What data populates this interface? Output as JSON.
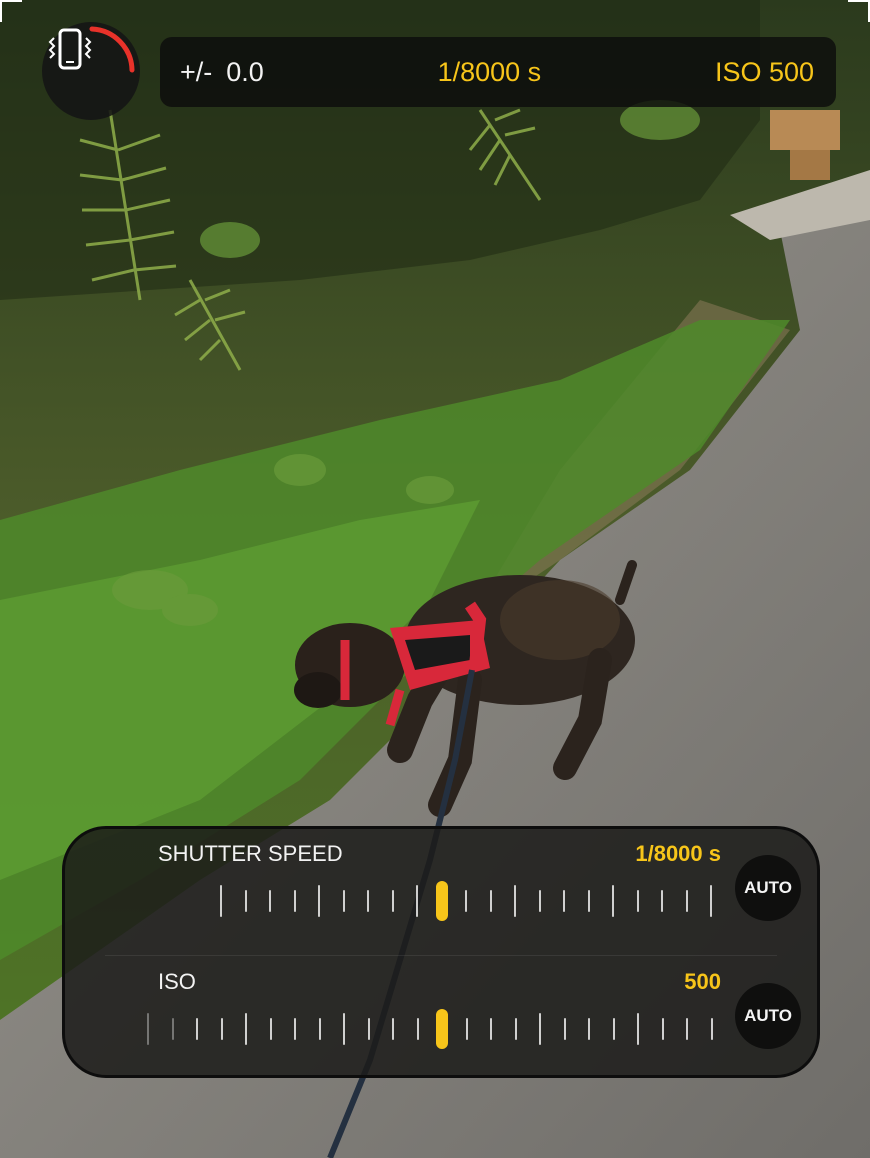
{
  "hud": {
    "stabilization_icon": "phone-shake-icon",
    "ev_symbol": "+/-",
    "ev_value": "0.0",
    "shutter_value": "1/8000 s",
    "iso_value": "ISO 500"
  },
  "controls": {
    "shutter": {
      "label": "SHUTTER SPEED",
      "value": "1/8000 s",
      "auto_label": "AUTO"
    },
    "iso": {
      "label": "ISO",
      "value": "500",
      "auto_label": "AUTO"
    }
  },
  "colors": {
    "accent": "#f7c51a",
    "warning_arc": "#e8322a"
  }
}
